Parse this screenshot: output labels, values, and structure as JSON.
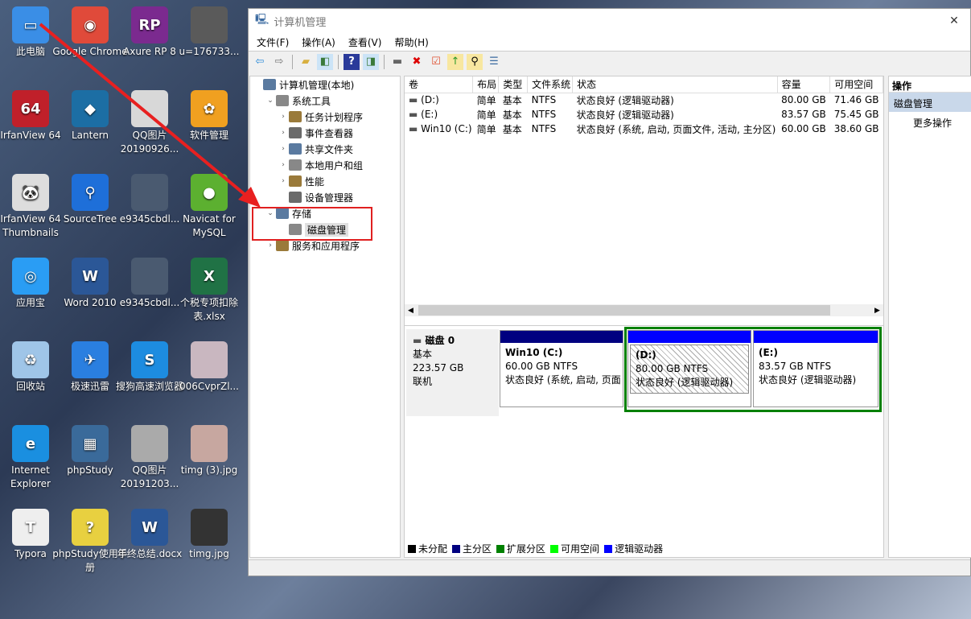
{
  "desktop": {
    "icons": [
      {
        "label": "此电脑",
        "color": "#3a8ee6",
        "glyph": "▭"
      },
      {
        "label": "Google Chrome",
        "color": "#e04a3a",
        "glyph": "◉"
      },
      {
        "label": "Axure RP 8",
        "color": "#7b2a8f",
        "glyph": "RP"
      },
      {
        "label": "u=176733...",
        "color": "#5a5a5a",
        "glyph": ""
      },
      {
        "label": "IrfanView 64",
        "color": "#c0202a",
        "glyph": "64"
      },
      {
        "label": "Lantern",
        "color": "#1c6ea4",
        "glyph": "◆"
      },
      {
        "label": "QQ图片 20190926...",
        "color": "#d8d8d8",
        "glyph": ""
      },
      {
        "label": "软件管理",
        "color": "#f0a020",
        "glyph": "✿"
      },
      {
        "label": "IrfanView 64 Thumbnails",
        "color": "#ddd",
        "glyph": "🐼"
      },
      {
        "label": "SourceTree",
        "color": "#1e6fd9",
        "glyph": "⚲"
      },
      {
        "label": "e9345cbdl...",
        "color": "#4a5a70",
        "glyph": ""
      },
      {
        "label": "Navicat for MySQL",
        "color": "#5cb030",
        "glyph": "●"
      },
      {
        "label": "应用宝",
        "color": "#2a9df4",
        "glyph": "◎"
      },
      {
        "label": "Word 2010",
        "color": "#2b5797",
        "glyph": "W"
      },
      {
        "label": "e9345cbdl...",
        "color": "#4a5a70",
        "glyph": ""
      },
      {
        "label": "个税专项扣除表.xlsx",
        "color": "#207245",
        "glyph": "X"
      },
      {
        "label": "回收站",
        "color": "#9fc5e8",
        "glyph": "♻"
      },
      {
        "label": "极速迅雷",
        "color": "#2a7fe0",
        "glyph": "✈"
      },
      {
        "label": "搜狗高速浏览器",
        "color": "#1d8ce0",
        "glyph": "S"
      },
      {
        "label": "006CvprZl...",
        "color": "#c9b7c0",
        "glyph": ""
      },
      {
        "label": "Internet Explorer",
        "color": "#1a8fe0",
        "glyph": "e"
      },
      {
        "label": "phpStudy",
        "color": "#3a6a9a",
        "glyph": "▦"
      },
      {
        "label": "QQ图片 20191203...",
        "color": "#aaa",
        "glyph": ""
      },
      {
        "label": "timg (3).jpg",
        "color": "#c7a7a0",
        "glyph": ""
      },
      {
        "label": "Typora",
        "color": "#eee",
        "glyph": "T"
      },
      {
        "label": "phpStudy使用手册",
        "color": "#e8d040",
        "glyph": "?"
      },
      {
        "label": "年终总结.docx",
        "color": "#2b5797",
        "glyph": "W"
      },
      {
        "label": "timg.jpg",
        "color": "#333",
        "glyph": ""
      }
    ]
  },
  "window": {
    "title": "计算机管理",
    "menu": [
      "文件(F)",
      "操作(A)",
      "查看(V)",
      "帮助(H)"
    ],
    "toolbar": [
      "back-icon",
      "forward-icon",
      "up-folder-icon",
      "show-hide-tree-icon",
      "help-icon",
      "show-hide-action-icon",
      "connect-drive-icon",
      "delete-icon",
      "properties-icon",
      "export-icon",
      "search-icon",
      "checklist-icon"
    ],
    "tree": [
      {
        "label": "计算机管理(本地)",
        "level": 0,
        "arrow": ""
      },
      {
        "label": "系统工具",
        "level": 1,
        "arrow": "⌄"
      },
      {
        "label": "任务计划程序",
        "level": 2,
        "arrow": "›"
      },
      {
        "label": "事件查看器",
        "level": 2,
        "arrow": "›"
      },
      {
        "label": "共享文件夹",
        "level": 2,
        "arrow": "›"
      },
      {
        "label": "本地用户和组",
        "level": 2,
        "arrow": "›"
      },
      {
        "label": "性能",
        "level": 2,
        "arrow": "›"
      },
      {
        "label": "设备管理器",
        "level": 2,
        "arrow": ""
      },
      {
        "label": "存储",
        "level": 1,
        "arrow": "⌄"
      },
      {
        "label": "磁盘管理",
        "level": 2,
        "arrow": "",
        "selected": true
      },
      {
        "label": "服务和应用程序",
        "level": 1,
        "arrow": "›"
      }
    ],
    "table": {
      "headers": [
        "卷",
        "布局",
        "类型",
        "文件系统",
        "状态",
        "容量",
        "可用空间"
      ],
      "rows": [
        [
          "(D:)",
          "简单",
          "基本",
          "NTFS",
          "状态良好 (逻辑驱动器)",
          "80.00 GB",
          "71.46 GB"
        ],
        [
          "(E:)",
          "简单",
          "基本",
          "NTFS",
          "状态良好 (逻辑驱动器)",
          "83.57 GB",
          "75.45 GB"
        ],
        [
          "Win10 (C:)",
          "简单",
          "基本",
          "NTFS",
          "状态良好 (系统, 启动, 页面文件, 活动, 主分区)",
          "60.00 GB",
          "38.60 GB"
        ]
      ]
    },
    "disk": {
      "name": "磁盘 0",
      "type": "基本",
      "size": "223.57 GB",
      "status": "联机",
      "partitions": [
        {
          "name": "Win10  (C:)",
          "size": "60.00 GB NTFS",
          "status": "状态良好 (系统, 启动, 页面",
          "color": "#000080"
        },
        {
          "name": "(D:)",
          "size": "80.00 GB NTFS",
          "status": "状态良好 (逻辑驱动器)",
          "color": "#0000ff"
        },
        {
          "name": "(E:)",
          "size": "83.57 GB NTFS",
          "status": "状态良好 (逻辑驱动器)",
          "color": "#0000ff"
        }
      ]
    },
    "legend": [
      {
        "label": "未分配",
        "color": "#000000"
      },
      {
        "label": "主分区",
        "color": "#000080"
      },
      {
        "label": "扩展分区",
        "color": "#008000"
      },
      {
        "label": "可用空间",
        "color": "#00ff00"
      },
      {
        "label": "逻辑驱动器",
        "color": "#0000ff"
      }
    ],
    "actions": {
      "header": "操作",
      "section": "磁盘管理",
      "more": "更多操作"
    }
  }
}
